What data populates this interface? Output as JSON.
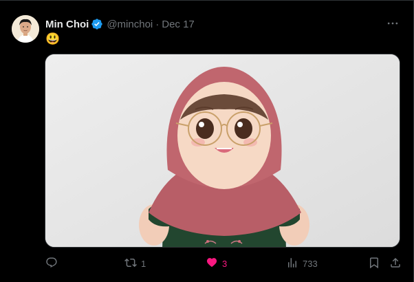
{
  "tweet": {
    "author_name": "Min Choi",
    "handle": "@minchoi",
    "separator": "·",
    "date": "Dec 17",
    "text": "😃",
    "media_alt": "Plush doll wearing a pink hijab and round glasses"
  },
  "actions": {
    "replies": "",
    "retweets": "1",
    "likes": "3",
    "views": "733"
  },
  "colors": {
    "background": "#000000",
    "text": "#e7e9ea",
    "secondary_text": "#71767b",
    "verified": "#1d9bf0",
    "like_active": "#f91880",
    "border": "#2f3336"
  },
  "icons": {
    "verified": "verified-badge-icon",
    "more": "more-horizontal-icon",
    "reply": "reply-icon",
    "retweet": "retweet-icon",
    "like": "heart-filled-icon",
    "views": "views-chart-icon",
    "bookmark": "bookmark-icon",
    "share": "share-icon"
  }
}
